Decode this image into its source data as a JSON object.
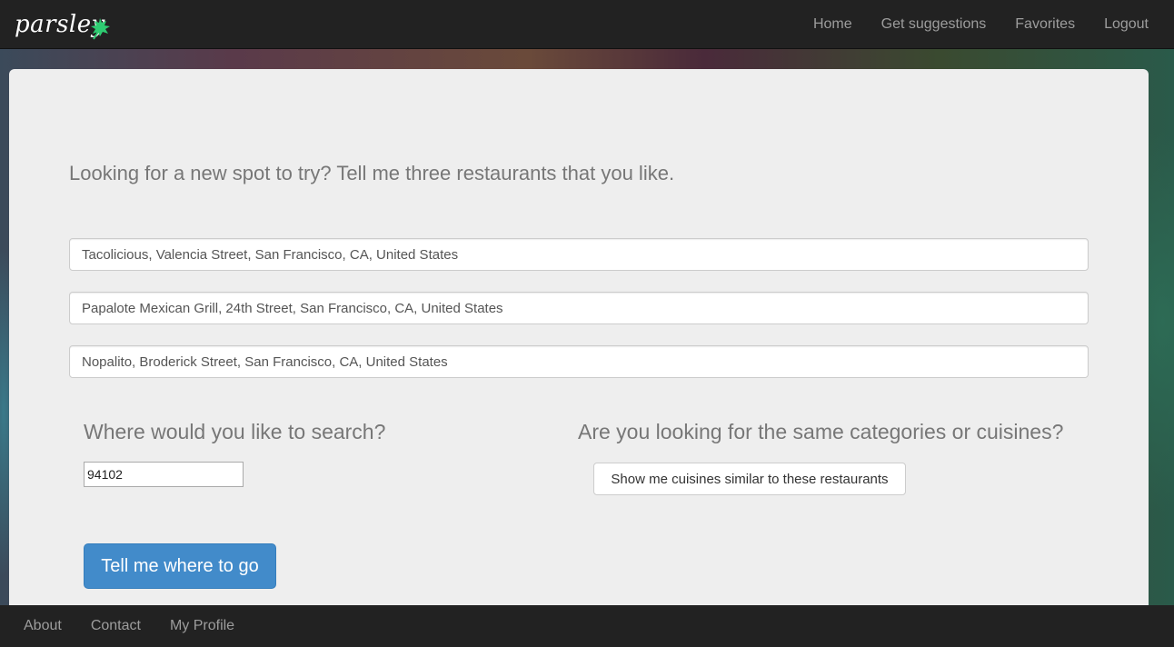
{
  "navbar": {
    "brand": "parsley",
    "links": [
      "Home",
      "Get suggestions",
      "Favorites",
      "Logout"
    ]
  },
  "main": {
    "lead": "Looking for a new spot to try? Tell me three restaurants that you like.",
    "restaurants": [
      "Tacolicious, Valencia Street, San Francisco, CA, United States",
      "Papalote Mexican Grill, 24th Street, San Francisco, CA, United States",
      "Nopalito, Broderick Street, San Francisco, CA, United States"
    ],
    "search_heading": "Where would you like to search?",
    "zip_value": "94102",
    "cuisine_heading": "Are you looking for the same categories or cuisines?",
    "similar_button": "Show me cuisines similar to these restaurants",
    "submit_button": "Tell me where to go"
  },
  "footer": {
    "links": [
      "About",
      "Contact",
      "My Profile"
    ]
  },
  "colors": {
    "navbar": "#222222",
    "panel": "#eeeeee",
    "primary": "#428bca",
    "leaf": "#2ecc71"
  },
  "icons": {
    "brand_leaf": "parsley-leaf-icon"
  }
}
